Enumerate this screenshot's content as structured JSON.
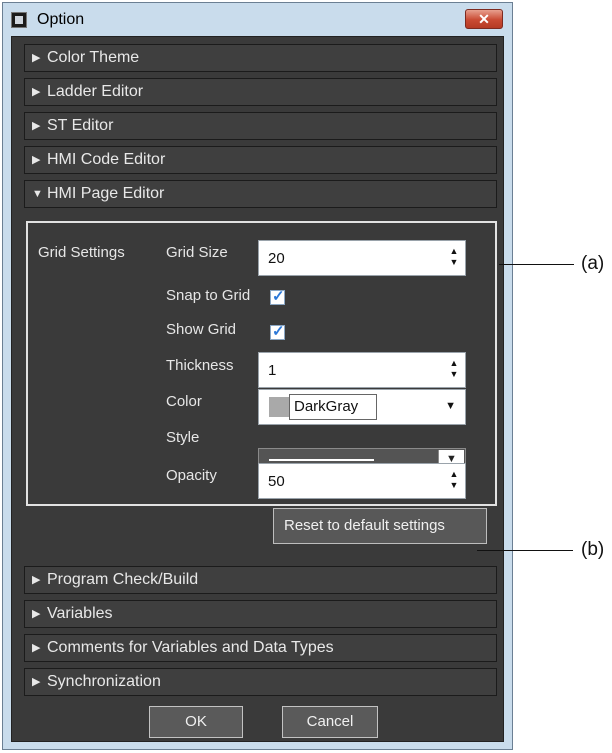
{
  "window": {
    "title": "Option",
    "close_glyph": "✕"
  },
  "sections_top": [
    {
      "label": "Color Theme",
      "arrow": "▶"
    },
    {
      "label": "Ladder Editor",
      "arrow": "▶"
    },
    {
      "label": "ST Editor",
      "arrow": "▶"
    },
    {
      "label": "HMI Code Editor",
      "arrow": "▶"
    },
    {
      "label": "HMI Page Editor",
      "arrow": "▼"
    }
  ],
  "grid": {
    "group_label": "Grid Settings",
    "grid_size_label": "Grid Size",
    "grid_size_value": "20",
    "snap_label": "Snap to Grid",
    "snap_checked": true,
    "show_label": "Show Grid",
    "show_checked": true,
    "thickness_label": "Thickness",
    "thickness_value": "1",
    "color_label": "Color",
    "color_value": "DarkGray",
    "color_swatch": "#a9a9a9",
    "style_label": "Style",
    "opacity_label": "Opacity",
    "opacity_value": "50"
  },
  "reset_button": "Reset to default settings",
  "sections_bottom": [
    {
      "label": "Program Check/Build",
      "arrow": "▶"
    },
    {
      "label": "Variables",
      "arrow": "▶"
    },
    {
      "label": "Comments for Variables and Data Types",
      "arrow": "▶"
    },
    {
      "label": "Synchronization",
      "arrow": "▶"
    }
  ],
  "buttons": {
    "ok": "OK",
    "cancel": "Cancel"
  },
  "callouts": {
    "a": "(a)",
    "b": "(b)"
  },
  "glyphs": {
    "spin_up": "▲",
    "spin_down": "▼",
    "dropdown": "▼",
    "check": "✓"
  }
}
